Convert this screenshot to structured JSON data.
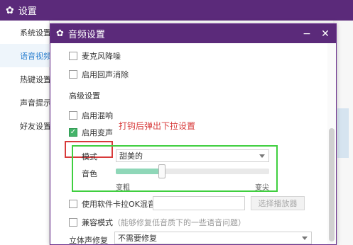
{
  "main_window": {
    "title": "设置",
    "icon": "gear-icon",
    "sidebar": [
      {
        "label": "系统设置",
        "active": false
      },
      {
        "label": "语音视频",
        "active": true
      },
      {
        "label": "热键设置",
        "active": false
      },
      {
        "label": "声音提示",
        "active": false
      },
      {
        "label": "好友设置",
        "active": false
      }
    ]
  },
  "dialog": {
    "title": "音频设置",
    "icon": "gear-icon",
    "minimize_label": "−",
    "close_label": "✕",
    "options": {
      "mic_denoise": {
        "label": "麦克风降噪",
        "checked": false
      },
      "echo_cancel": {
        "label": "启用回声消除",
        "checked": false
      }
    },
    "advanced_heading": "高级设置",
    "reverb": {
      "label": "启用混响",
      "checked": false
    },
    "voice_change": {
      "label": "启用变声",
      "checked": true
    },
    "annotation": "打钩后弹出下拉设置",
    "mode": {
      "label": "模式",
      "value": "甜美的"
    },
    "timbre": {
      "label": "音色",
      "left_label": "变粗",
      "right_label": "变尖",
      "level": 0.3
    },
    "karaoke": {
      "label": "使用软件卡拉OK混音",
      "checked": false,
      "input_value": "",
      "button_label": "选择播放器"
    },
    "compat": {
      "label": "兼容模式",
      "hint": "（能够修复低音质下的一些语音问题）",
      "checked": false
    },
    "stereo": {
      "label": "立体声修复",
      "value": "不需要修复"
    }
  },
  "colors": {
    "titlebar": "#5b2a7a",
    "annotation_red": "#d83a3a",
    "highlight_green": "#3fcf3f",
    "slider_fill": "#8fd7b8",
    "check_green": "#44b46a"
  }
}
